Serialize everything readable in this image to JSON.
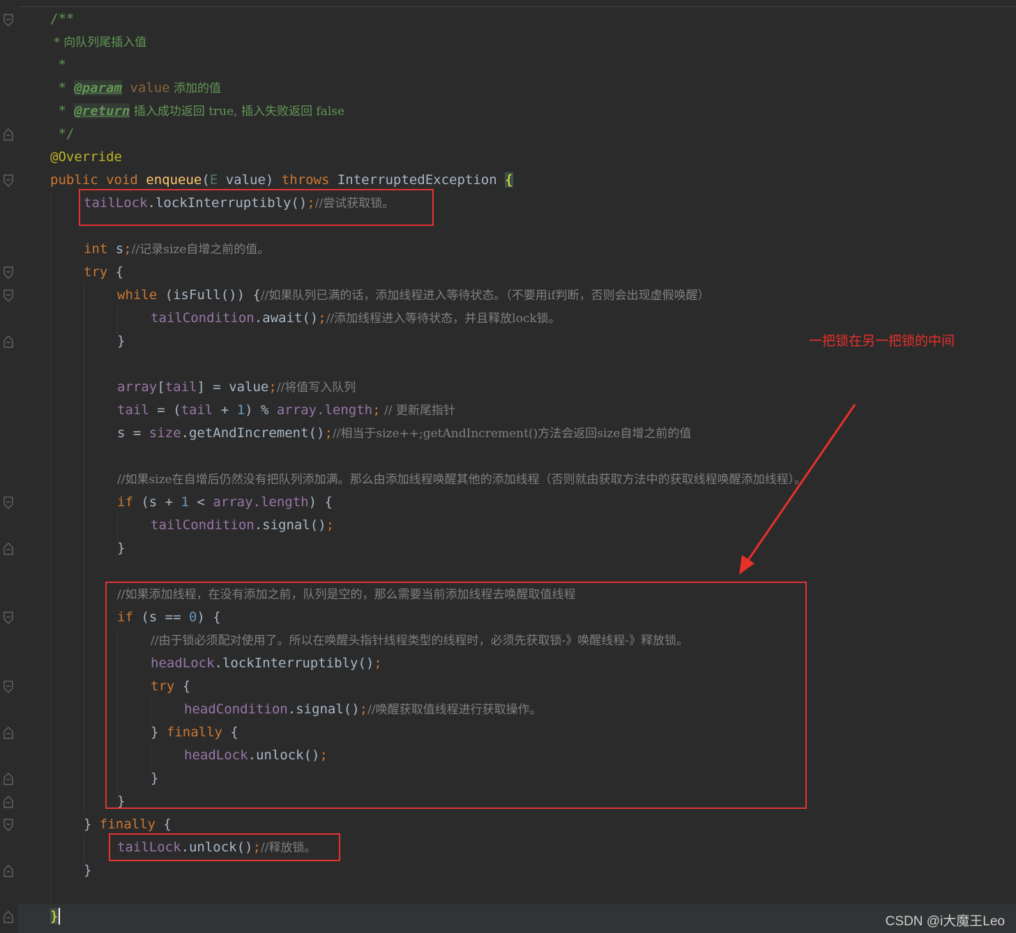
{
  "editor": {
    "lines": [
      {
        "id": "l1",
        "text": "/**"
      },
      {
        "id": "l2",
        "text": " * 向队列尾插入值"
      },
      {
        "id": "l3",
        "text": " *"
      },
      {
        "id": "l4a",
        "text": " * "
      },
      {
        "id": "l4b",
        "text": "@param"
      },
      {
        "id": "l4c",
        "text": " value"
      },
      {
        "id": "l4d",
        "text": " 添加的值"
      },
      {
        "id": "l5a",
        "text": " * "
      },
      {
        "id": "l5b",
        "text": "@return"
      },
      {
        "id": "l5c",
        "text": " 插入成功返回 true, 插入失败返回 false"
      },
      {
        "id": "l6",
        "text": " */"
      },
      {
        "id": "l7",
        "text": "@Override"
      }
    ],
    "code": {
      "sig_public": "public void ",
      "sig_method": "enqueue",
      "sig_open": "(",
      "sig_E": "E",
      "sig_rest": " value) ",
      "sig_throws": "throws",
      "sig_exc": " InterruptedException ",
      "sig_brace": "{",
      "tailLock1": "tailLock",
      "lockInt1": ".lockInterruptibly()",
      "semi1": ";",
      "cmt1": "//尝试获取锁。",
      "int_kw": "int",
      "int_s": " s",
      "semi2": ";",
      "cmt2": "//记录size自增之前的值。",
      "try_kw": "try",
      "try_brace": " {",
      "while_kw": "while",
      "while_rest": " (isFull()) {",
      "cmt3": "//如果队列已满的话，添加线程进入等待状态。（不要用if判断，否则会出现虚假唤醒）",
      "tailCond1": "tailCondition",
      "await1": ".await()",
      "semi3": ";",
      "cmt4": "//添加线程进入等待状态，并且释放lock锁。",
      "close1": "}",
      "array1": "array",
      "br1": "[",
      "tail1": "tail",
      "br2": "] = value",
      "semi4": ";",
      "cmt5": "//将值写入队列",
      "tail2": "tail",
      "eq2": " = (",
      "tail3": "tail",
      "plus2": " + ",
      "one2": "1",
      "mod2": ") % ",
      "array2": "array",
      "len2": ".length",
      "semi5": ";",
      "cmt6": " // 更新尾指针",
      "s_eq": "s = ",
      "size1": "size",
      "gai": ".getAndIncrement()",
      "semi6": ";",
      "cmt7": "//相当于size++;getAndIncrement()方法会返回size自增之前的值",
      "cmt8": "//如果size在自增后仍然没有把队列添加满。那么由添加线程唤醒其他的添加线程（否则就由获取方法中的获取线程唤醒添加线程）。",
      "if1": "if",
      "if1_a": " (s + ",
      "if1_one": "1",
      "if1_b": " < ",
      "if1_array": "array",
      "if1_len": ".length",
      "if1_c": ") {",
      "tailCond2": "tailCondition",
      "signal1": ".signal()",
      "semi7": ";",
      "close2": "}",
      "cmt9": "//如果添加线程，在没有添加之前，队列是空的，那么需要当前添加线程去唤醒取值线程",
      "if2": "if",
      "if2_a": " (s == ",
      "if2_zero": "0",
      "if2_b": ") {",
      "cmt10": "//由于锁必须配对使用了。所以在唤醒头指针线程类型的线程时，必须先获取锁-》唤醒线程-》释放锁。",
      "headLock1": "headLock",
      "lockInt2": ".lockInterruptibly()",
      "semi8": ";",
      "try2": "try",
      "try2_brace": " {",
      "headCond": "headCondition",
      "signal2": ".signal()",
      "semi9": ";",
      "cmt11": "//唤醒获取值线程进行获取操作。",
      "fin1_open": "} ",
      "fin1": "finally",
      "fin1_brace": " {",
      "headLock2": "headLock",
      "unlock1": ".unlock()",
      "semi10": ";",
      "close3": "}",
      "close4": "}",
      "fin2_open": "} ",
      "fin2": "finally",
      "fin2_brace": " {",
      "tailLock2": "tailLock",
      "unlock2": ".unlock()",
      "semi11": ";",
      "cmt12": "//释放锁。",
      "close5": "}",
      "close6": "}"
    }
  },
  "annotation": {
    "text": "一把锁在另一把锁的中间"
  },
  "watermark": {
    "text": "CSDN @i大魔王Leo"
  },
  "colors": {
    "background": "#2b2b2b",
    "keyword": "#cc7832",
    "field": "#9876aa",
    "comment": "#808080",
    "javadoc": "#629755",
    "method": "#ffc66d",
    "number": "#6897bb",
    "annotation_box": "#e53333"
  },
  "icons": [
    "fold-open-icon",
    "fold-close-icon"
  ]
}
